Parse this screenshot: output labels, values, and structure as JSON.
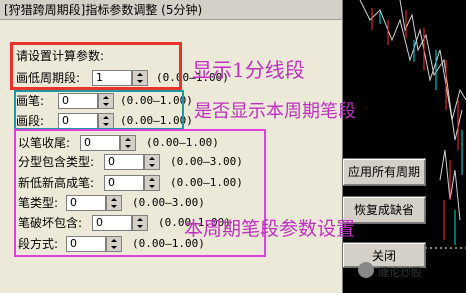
{
  "dialog": {
    "title": "[狩猎跨周期段]指标参数调整 (5分钟)",
    "header_label": "请设置计算参数:",
    "rows": [
      {
        "label": "画低周期段:",
        "value": "1",
        "range": "(0.00—1.00)"
      },
      {
        "label": "画笔:",
        "value": "0",
        "range": "(0.00—1.00)"
      },
      {
        "label": "画段:",
        "value": "0",
        "range": "(0.00—1.00)"
      },
      {
        "label": "以笔收尾:",
        "value": "0",
        "range": "(0.00—1.00)"
      },
      {
        "label": "分型包含类型:",
        "value": "0",
        "range": "(0.00—3.00)"
      },
      {
        "label": "新低新高成笔:",
        "value": "0",
        "range": "(0.00—1.00)"
      },
      {
        "label": "笔类型:",
        "value": "0",
        "range": "(0.00—3.00)"
      },
      {
        "label": "笔破坏包含:",
        "value": "0",
        "range": "(0.00—1.00)"
      },
      {
        "label": "段方式:",
        "value": "0",
        "range": "(0.00—1.00)"
      }
    ],
    "buttons": {
      "apply_all": "应用所有周期",
      "restore_default": "恢复成缺省",
      "close": "关闭"
    }
  },
  "annotations": {
    "show_1min": "显示1分线段",
    "show_current": "是否显示本周期笔段",
    "current_settings": "本周期笔段参数设置"
  },
  "watermark": "缠论炒股",
  "colors": {
    "red_box": "#e8342c",
    "teal_box": "#1a9aa0",
    "magenta_box": "#e040e0",
    "annot_text": "#c030c0"
  }
}
